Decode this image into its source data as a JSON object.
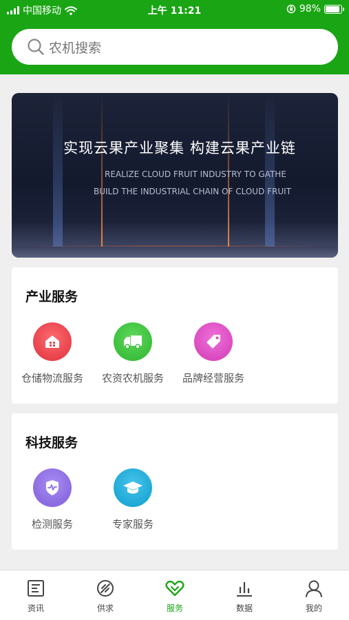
{
  "status_bar": {
    "carrier": "中国移动",
    "time": "上午 11:21",
    "battery": "98%"
  },
  "search": {
    "placeholder": "农机搜索"
  },
  "banner": {
    "title": "实现云果产业聚集  构建云果产业链",
    "subtitle_line1": "REALIZE CLOUD FRUIT INDUSTRY TO GATHE",
    "subtitle_line2": "BUILD THE INDUSTRIAL CHAIN OF CLOUD FRUIT"
  },
  "industry_services": {
    "heading": "产业服务",
    "items": [
      {
        "label": "仓储物流服务",
        "icon": "warehouse-icon",
        "color": "#e8424c"
      },
      {
        "label": "农资农机服务",
        "icon": "truck-icon",
        "color": "#3cbf3c"
      },
      {
        "label": "品牌经营服务",
        "icon": "tag-icon",
        "color": "#d94bbf"
      }
    ]
  },
  "tech_services": {
    "heading": "科技服务",
    "items": [
      {
        "label": "检测服务",
        "icon": "shield-icon",
        "color": "#8a6be0"
      },
      {
        "label": "专家服务",
        "icon": "graduation-cap-icon",
        "color": "#1fa9d6"
      }
    ]
  },
  "tabbar": {
    "active_color": "#1aa514",
    "tabs": [
      {
        "label": "资讯",
        "icon": "news-icon"
      },
      {
        "label": "供求",
        "icon": "supply-demand-icon"
      },
      {
        "label": "服务",
        "icon": "heart-icon",
        "active": true
      },
      {
        "label": "数据",
        "icon": "bar-chart-icon"
      },
      {
        "label": "我的",
        "icon": "user-icon"
      }
    ]
  }
}
